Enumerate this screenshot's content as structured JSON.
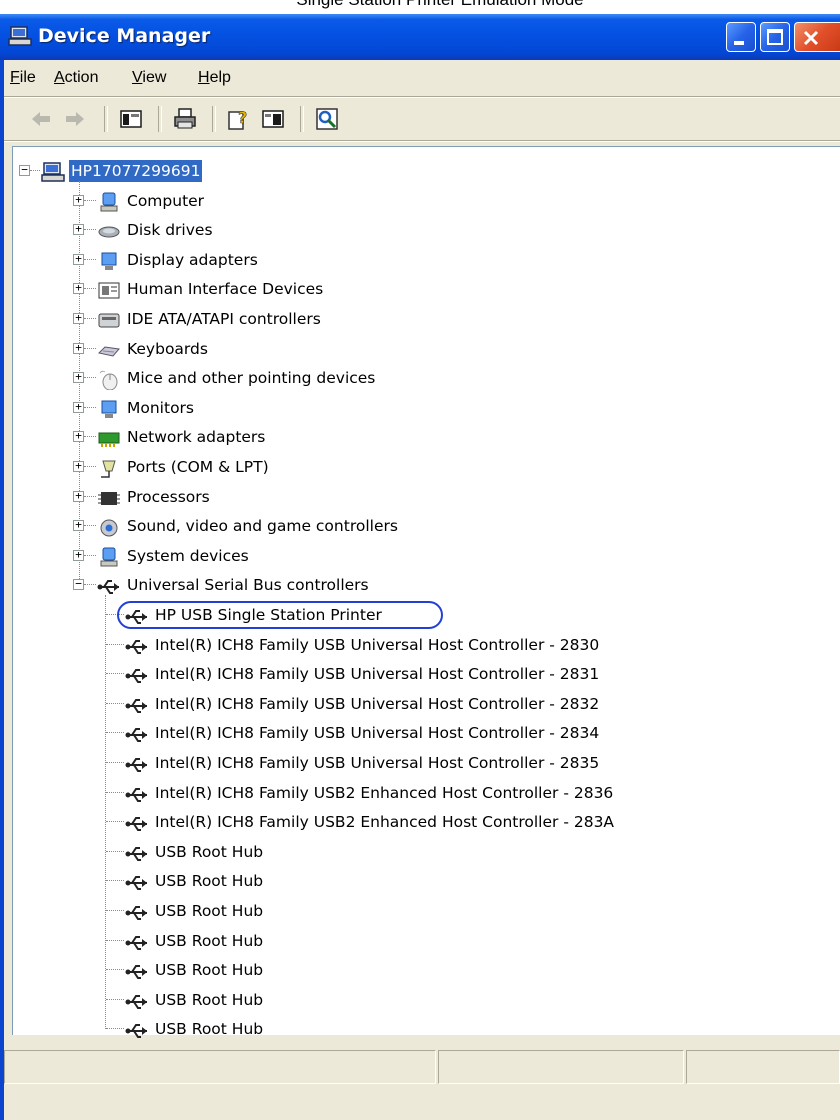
{
  "caption": "Single Station Printer Emulation Mode",
  "window": {
    "title": "Device Manager"
  },
  "menu": [
    "File",
    "Action",
    "View",
    "Help"
  ],
  "tree": {
    "root": "HP17077299691",
    "categories": [
      {
        "label": "Computer",
        "icon": "computer-icon"
      },
      {
        "label": "Disk drives",
        "icon": "disk-drive-icon"
      },
      {
        "label": "Display adapters",
        "icon": "display-adapter-icon"
      },
      {
        "label": "Human Interface Devices",
        "icon": "hid-icon"
      },
      {
        "label": "IDE ATA/ATAPI controllers",
        "icon": "ide-controller-icon"
      },
      {
        "label": "Keyboards",
        "icon": "keyboard-icon"
      },
      {
        "label": "Mice and other pointing devices",
        "icon": "mouse-icon"
      },
      {
        "label": "Monitors",
        "icon": "monitor-icon"
      },
      {
        "label": "Network adapters",
        "icon": "network-adapter-icon"
      },
      {
        "label": "Ports (COM & LPT)",
        "icon": "port-icon"
      },
      {
        "label": "Processors",
        "icon": "processor-icon"
      },
      {
        "label": "Sound, video and game controllers",
        "icon": "sound-icon"
      },
      {
        "label": "System devices",
        "icon": "system-devices-icon"
      },
      {
        "label": "Universal Serial Bus controllers",
        "icon": "usb-icon"
      }
    ],
    "usb_children": [
      "HP USB Single Station Printer",
      "Intel(R) ICH8 Family USB Universal Host Controller - 2830",
      "Intel(R) ICH8 Family USB Universal Host Controller - 2831",
      "Intel(R) ICH8 Family USB Universal Host Controller - 2832",
      "Intel(R) ICH8 Family USB Universal Host Controller - 2834",
      "Intel(R) ICH8 Family USB Universal Host Controller - 2835",
      "Intel(R) ICH8 Family USB2 Enhanced Host Controller - 2836",
      "Intel(R) ICH8 Family USB2 Enhanced Host Controller - 283A",
      "USB Root Hub",
      "USB Root Hub",
      "USB Root Hub",
      "USB Root Hub",
      "USB Root Hub",
      "USB Root Hub",
      "USB Root Hub"
    ]
  },
  "colors": {
    "titlebar": "#0450e0",
    "selection": "#316ac5",
    "highlight_oval": "#2340d6"
  }
}
